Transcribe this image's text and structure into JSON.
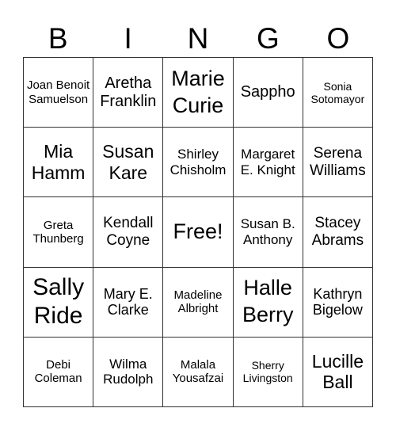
{
  "header": [
    "B",
    "I",
    "N",
    "G",
    "O"
  ],
  "cells": [
    "Joan Benoit Samuelson",
    "Aretha Franklin",
    "Marie Curie",
    "Sappho",
    "Sonia Sotomayor",
    "Mia Hamm",
    "Susan Kare",
    "Shirley Chisholm",
    "Margaret E. Knight",
    "Serena Williams",
    "Greta Thunberg",
    "Kendall Coyne",
    "Free!",
    "Susan B. Anthony",
    "Stacey Abrams",
    "Sally Ride",
    "Mary E. Clarke",
    "Madeline Albright",
    "Halle Berry",
    "Kathryn Bigelow",
    "Debi Coleman",
    "Wilma Rudolph",
    "Malala Yousafzai",
    "Sherry Livingston",
    "Lucille Ball"
  ]
}
